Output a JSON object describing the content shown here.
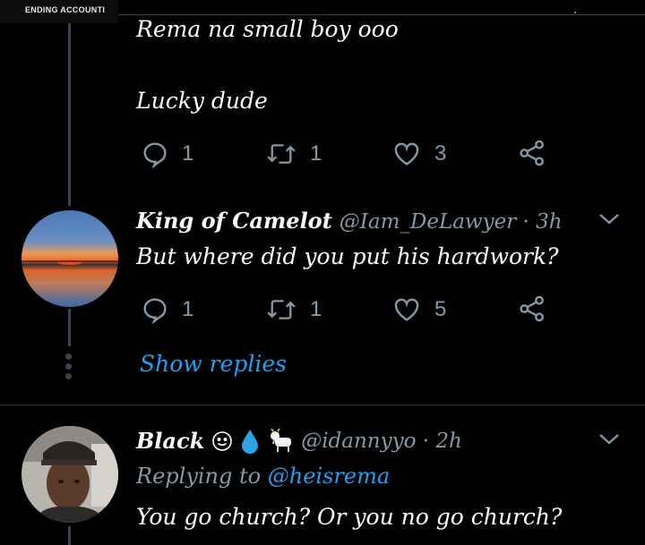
{
  "header": {
    "chip_text": "ENDING ACCOUNTI"
  },
  "tweet1": {
    "line1": "Rema na small boy ooo",
    "line2": "Lucky dude",
    "reply_count": "1",
    "retweet_count": "1",
    "like_count": "3"
  },
  "tweet2": {
    "name": "King of Camelot",
    "handle": "@Iam_DeLawyer · 3h",
    "text": "But where did you put his hardwork?",
    "reply_count": "1",
    "retweet_count": "1",
    "like_count": "5",
    "show_replies": "Show replies"
  },
  "tweet3": {
    "name": "Black",
    "emojis": [
      "smiling-face-emoji",
      "droplet-emoji",
      "goat-emoji"
    ],
    "handle": "@idannyyo · 2h",
    "replying_label": "Replying to",
    "replying_to": "@heisrema",
    "text": "You go church?  Or you no go church?"
  },
  "colors": {
    "background": "#000000",
    "text": "#ffffff",
    "secondary": "#8899a6",
    "link": "#1da1f2",
    "thread_line": "#3a4450"
  }
}
